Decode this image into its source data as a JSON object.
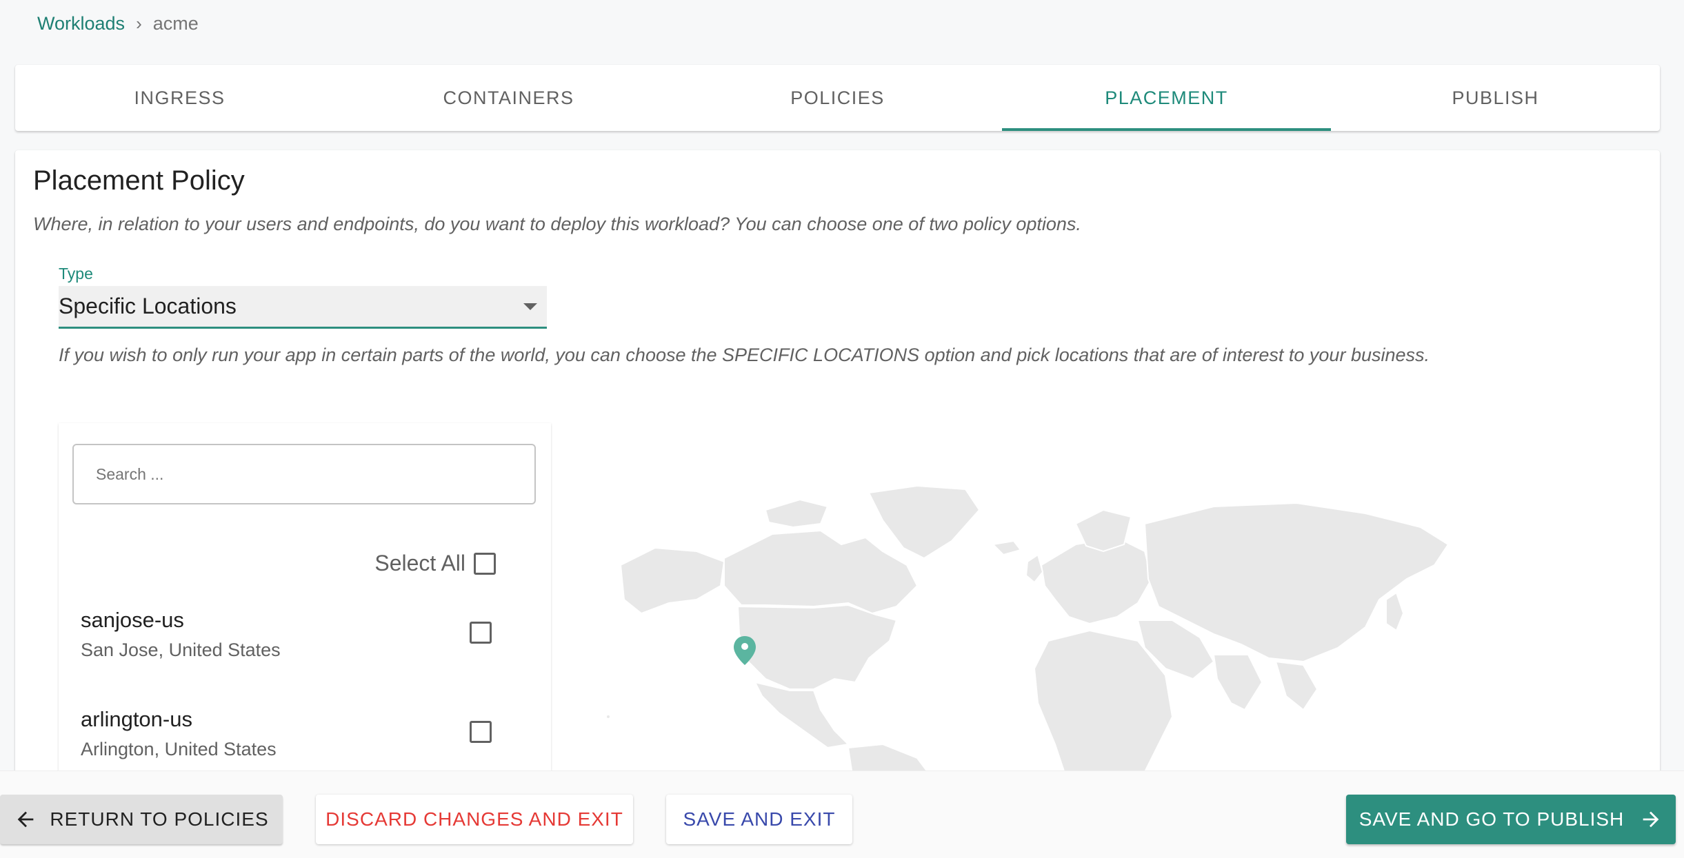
{
  "breadcrumb": {
    "parent": "Workloads",
    "separator": "›",
    "current": "acme"
  },
  "tabs": [
    {
      "label": "INGRESS",
      "active": false
    },
    {
      "label": "CONTAINERS",
      "active": false
    },
    {
      "label": "POLICIES",
      "active": false
    },
    {
      "label": "PLACEMENT",
      "active": true
    },
    {
      "label": "PUBLISH",
      "active": false
    }
  ],
  "placement": {
    "title": "Placement Policy",
    "description": "Where, in relation to your users and endpoints, do you want to deploy this workload? You can choose one of two policy options.",
    "type_label": "Type",
    "type_value": "Specific Locations",
    "type_help": "If you wish to only run your app in certain parts of the world, you can choose the SPECIFIC LOCATIONS option and pick locations that are of interest to your business."
  },
  "locations": {
    "search_placeholder": "Search ...",
    "select_all_label": "Select All",
    "items": [
      {
        "name": "sanjose-us",
        "city": "San Jose, United States",
        "checked": false
      },
      {
        "name": "arlington-us",
        "city": "Arlington, United States",
        "checked": false
      }
    ]
  },
  "map": {
    "land_color": "#e8e8e8",
    "border_color": "#ffffff",
    "marker_color": "#5bb5a0",
    "marker_icon": "map-pin-icon"
  },
  "actions": {
    "return_label": "RETURN TO POLICIES",
    "discard_label": "DISCARD CHANGES AND EXIT",
    "save_exit_label": "SAVE AND EXIT",
    "publish_label": "SAVE AND GO TO PUBLISH"
  },
  "colors": {
    "accent": "#2d8f7f",
    "discard": "#e53935",
    "save_exit": "#3949ab"
  }
}
